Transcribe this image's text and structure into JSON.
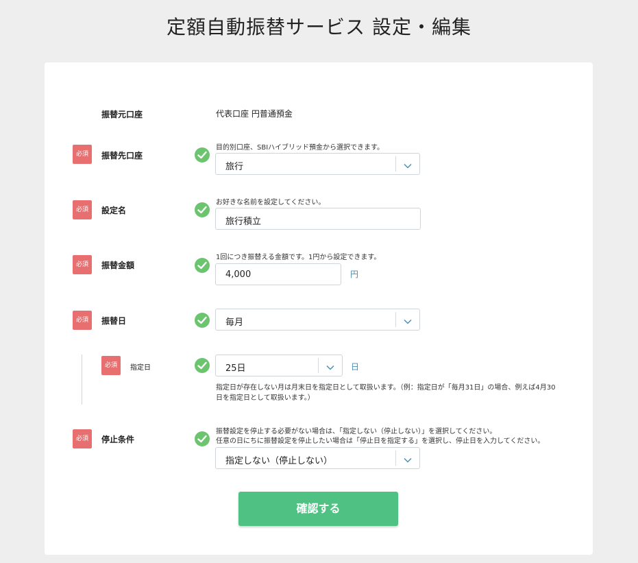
{
  "page": {
    "title": "定額自動振替サービス 設定・編集"
  },
  "colors": {
    "required_badge": "#e86f6f",
    "check": "#6cc46f",
    "confirm_button": "#4fc182",
    "unit_text": "#4a8fb0"
  },
  "required_label": "必須",
  "form": {
    "source_account": {
      "label": "振替元口座",
      "value": "代表口座 円普通預金"
    },
    "dest_account": {
      "label": "振替先口座",
      "hint": "目的別口座、SBIハイブリッド預金から選択できます。",
      "value": "旅行"
    },
    "setting_name": {
      "label": "設定名",
      "hint": "お好きな名前を設定してください。",
      "value": "旅行積立"
    },
    "amount": {
      "label": "振替金額",
      "hint": "1回につき振替える金額です。1円から設定できます。",
      "value": "4,000",
      "unit": "円"
    },
    "transfer_day": {
      "label": "振替日",
      "value": "毎月"
    },
    "specified_day": {
      "label": "指定日",
      "value": "25日",
      "unit": "日",
      "note_line1": "指定日が存在しない月は月末日を指定日として取扱います。（例：指定日が「毎月31日」の場合、例えば4月30",
      "note_line2": "日を指定日として取扱います。）"
    },
    "stop_condition": {
      "label": "停止条件",
      "hint_line1": "振替設定を停止する必要がない場合は、「指定しない（停止しない）」を選択してください。",
      "hint_line2": "任意の日にちに振替設定を停止したい場合は「停止日を指定する」を選択し、停止日を入力してください。",
      "value": "指定しない（停止しない）"
    }
  },
  "confirm_button": "確認する"
}
